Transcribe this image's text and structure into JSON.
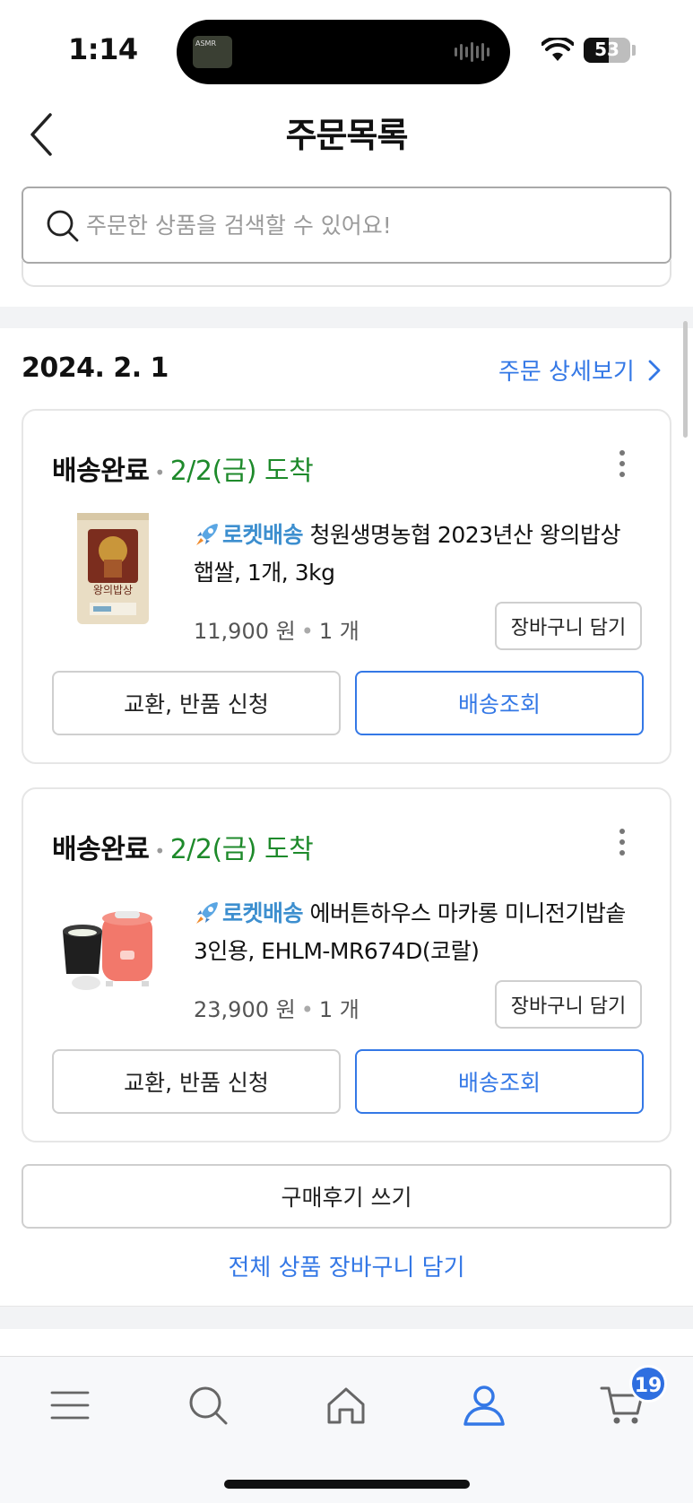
{
  "status_bar": {
    "time": "1:14",
    "island_thumb_text": "ASMR",
    "battery": {
      "level": "53",
      "fraction": 0.53
    }
  },
  "header": {
    "title": "주문목록"
  },
  "search": {
    "placeholder": "주문한 상품을 검색할 수 있어요!",
    "value": ""
  },
  "order_group": {
    "date": "2024. 2. 1",
    "detail_link": "주문 상세보기",
    "items": [
      {
        "status": "배송완료",
        "arrival": "2/2(금) 도착",
        "delivery_label": "로켓배송",
        "product_name": "청원생명농협 2023년산 왕의밥상 햅쌀, 1개, 3kg",
        "price": "11,900 원",
        "quantity": "1 개",
        "cart_button": "장바구니 담기",
        "return_button": "교환, 반품 신청",
        "track_button": "배송조회",
        "thumb_icon": "rice-bag-image"
      },
      {
        "status": "배송완료",
        "arrival": "2/2(금) 도착",
        "delivery_label": "로켓배송",
        "product_name": "에버튼하우스 마카롱 미니전기밥솥 3인용, EHLM-MR674D(코랄)",
        "price": "23,900 원",
        "quantity": "1 개",
        "cart_button": "장바구니 담기",
        "return_button": "교환, 반품 신청",
        "track_button": "배송조회",
        "thumb_icon": "rice-cooker-image"
      }
    ],
    "review_button": "구매후기 쓰기",
    "add_all_link": "전체 상품 장바구니 담기"
  },
  "bottom_nav": {
    "items": [
      "menu-icon",
      "search-icon",
      "home-icon",
      "account-icon",
      "cart-icon"
    ],
    "active": "account-icon",
    "cart_count": "19"
  },
  "colors": {
    "accent": "#3478e6",
    "arrival_green": "#1e8a2b",
    "rocket_blue": "#3d8fcf",
    "badge": "#2f6fe0"
  }
}
